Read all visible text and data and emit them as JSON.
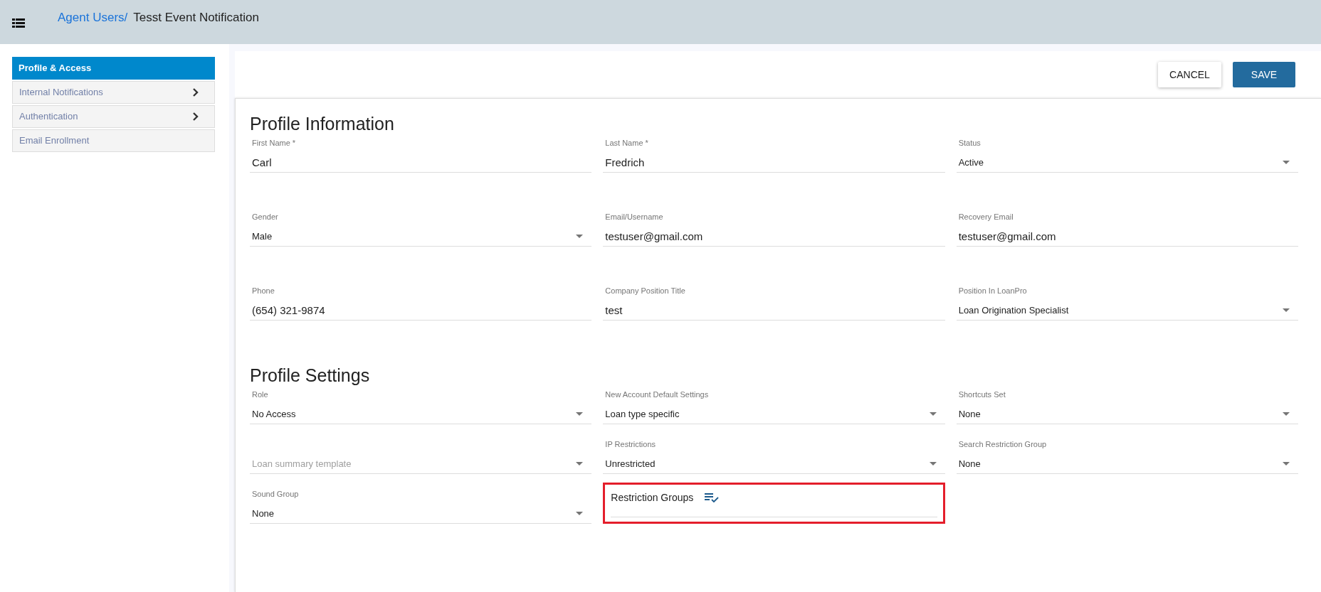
{
  "header": {
    "breadcrumb_link": "Agent Users",
    "separator": "/",
    "current": "Tesst Event Notification"
  },
  "sidebar": {
    "items": [
      {
        "label": "Profile & Access",
        "selected": true,
        "expandable": false
      },
      {
        "label": "Internal Notifications",
        "selected": false,
        "expandable": true
      },
      {
        "label": "Authentication",
        "selected": false,
        "expandable": true
      },
      {
        "label": "Email Enrollment",
        "selected": false,
        "expandable": false
      }
    ]
  },
  "actions": [
    {
      "label": "CANCEL",
      "kind": "secondary"
    },
    {
      "label": "SAVE",
      "kind": "primary"
    }
  ],
  "sections": [
    {
      "title": "Profile Information",
      "rows": [
        [
          {
            "kind": "text",
            "label": "First Name *",
            "value": "Carl"
          },
          {
            "kind": "text",
            "label": "Last Name *",
            "value": "Fredrich"
          },
          {
            "kind": "select",
            "label": "Status",
            "value": "Active"
          }
        ],
        [
          {
            "kind": "select",
            "label": "Gender",
            "value": "Male"
          },
          {
            "kind": "text",
            "label": "Email/Username",
            "value": "testuser@gmail.com"
          },
          {
            "kind": "text",
            "label": "Recovery Email",
            "value": "testuser@gmail.com"
          }
        ],
        [
          {
            "kind": "text",
            "label": "Phone",
            "value": "(654) 321-9874"
          },
          {
            "kind": "text",
            "label": "Company Position Title",
            "value": "test"
          },
          {
            "kind": "select",
            "label": "Position In LoanPro",
            "value": "Loan Origination Specialist"
          }
        ]
      ]
    },
    {
      "title": "Profile Settings",
      "rows": [
        [
          {
            "kind": "select",
            "label": "Role",
            "value": "No Access"
          },
          {
            "kind": "select",
            "label": "New Account Default Settings",
            "value": "Loan type specific"
          },
          {
            "kind": "select",
            "label": "Shortcuts Set",
            "value": "None"
          }
        ],
        [
          {
            "kind": "select",
            "placeholder": "Loan summary template"
          },
          {
            "kind": "select",
            "label": "IP Restrictions",
            "value": "Unrestricted"
          },
          {
            "kind": "select",
            "label": "Search Restriction Group",
            "value": "None"
          }
        ],
        [
          {
            "kind": "select",
            "label": "Sound Group",
            "value": "None"
          },
          {
            "kind": "list",
            "label": "Restriction Groups",
            "highlighted": true
          }
        ]
      ]
    }
  ]
}
